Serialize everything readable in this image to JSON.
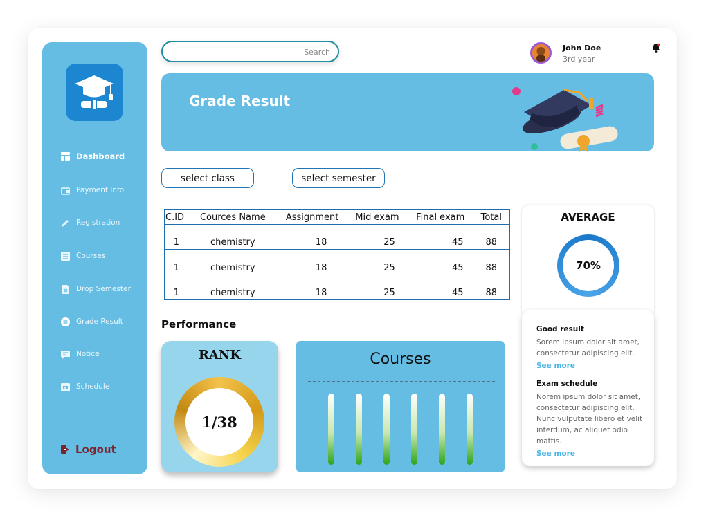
{
  "sidebar": {
    "logo_icon": "graduation-cap-icon",
    "items": [
      {
        "label": "Dashboard",
        "icon": "dashboard-icon"
      },
      {
        "label": "Payment Info",
        "icon": "wallet-icon"
      },
      {
        "label": "Registration",
        "icon": "pencil-icon"
      },
      {
        "label": "Courses",
        "icon": "list-icon"
      },
      {
        "label": "Drop Semester",
        "icon": "file-x-icon"
      },
      {
        "label": "Grade Result",
        "icon": "circle-lines-icon"
      },
      {
        "label": "Notice",
        "icon": "message-icon"
      },
      {
        "label": "Schedule",
        "icon": "calendar-icon"
      }
    ],
    "logout_label": "Logout",
    "colors": {
      "background": "#65bde3",
      "logo_box": "#1d86d1",
      "logout": "#7a2430"
    }
  },
  "search": {
    "placeholder": "Search"
  },
  "user": {
    "name": "John Doe",
    "year": "3rd year"
  },
  "banner": {
    "title": "Grade Result"
  },
  "filters": {
    "class_label": "select class",
    "semester_label": "select semester"
  },
  "table": {
    "headers": [
      "C.ID",
      "Cources Name",
      "Assignment",
      "Mid exam",
      "Final exam",
      "Total"
    ],
    "rows": [
      [
        "1",
        "chemistry",
        "18",
        "25",
        "45",
        "88"
      ],
      [
        "1",
        "chemistry",
        "18",
        "25",
        "45",
        "88"
      ],
      [
        "1",
        "chemistry",
        "18",
        "25",
        "45",
        "88"
      ]
    ]
  },
  "performance": {
    "title": "Performance",
    "rank_title": "RANK",
    "rank_value": "1/38",
    "courses_title": "Courses",
    "course_bar_count": 6
  },
  "average": {
    "title": "AVERAGE",
    "value": "70%"
  },
  "info": {
    "good_title": "Good result",
    "good_text": "Sorem ipsum dolor sit amet, consectetur adipiscing elit.",
    "good_link": "See more",
    "exam_title": "Exam schedule",
    "exam_text": "Norem ipsum dolor sit amet, consectetur adipiscing elit. Nunc vulputate libero et velit interdum, ac aliquet odio mattis.",
    "exam_link": "See more"
  }
}
